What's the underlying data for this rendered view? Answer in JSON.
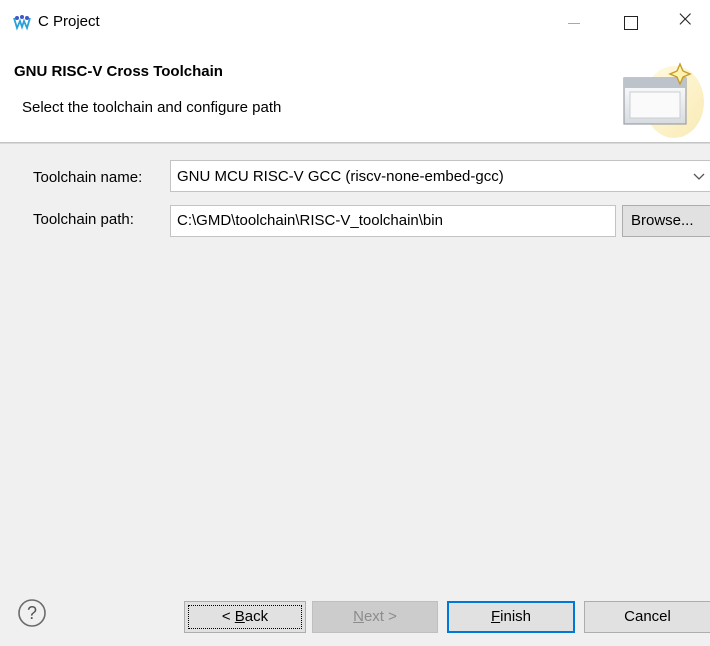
{
  "window": {
    "title": "C Project",
    "icon": "gowin-logo-icon",
    "controls": {
      "minimize": "minimize-icon",
      "maximize": "maximize-icon",
      "close": "×"
    }
  },
  "header": {
    "title": "GNU RISC-V Cross Toolchain",
    "description": "Select the toolchain and configure path",
    "graphic": "wizard-banner-icon"
  },
  "form": {
    "toolchain_name": {
      "label": "Toolchain name:",
      "value": "GNU MCU RISC-V GCC (riscv-none-embed-gcc)"
    },
    "toolchain_path": {
      "label": "Toolchain path:",
      "value": "C:\\GMD\\toolchain\\RISC-V_toolchain\\bin",
      "browse_label": "Browse..."
    }
  },
  "footer": {
    "help_icon": "help-icon",
    "back": {
      "prefix": "< ",
      "mnemonic": "B",
      "rest": "ack"
    },
    "next": {
      "mnemonic": "N",
      "rest": "ext >"
    },
    "finish": {
      "mnemonic": "F",
      "rest": "inish"
    },
    "cancel": "Cancel"
  },
  "colors": {
    "dialog_bg": "#f0f0f0",
    "header_bg": "#ffffff",
    "accent": "#0078d7",
    "disabled_text": "#8c8c8c"
  }
}
